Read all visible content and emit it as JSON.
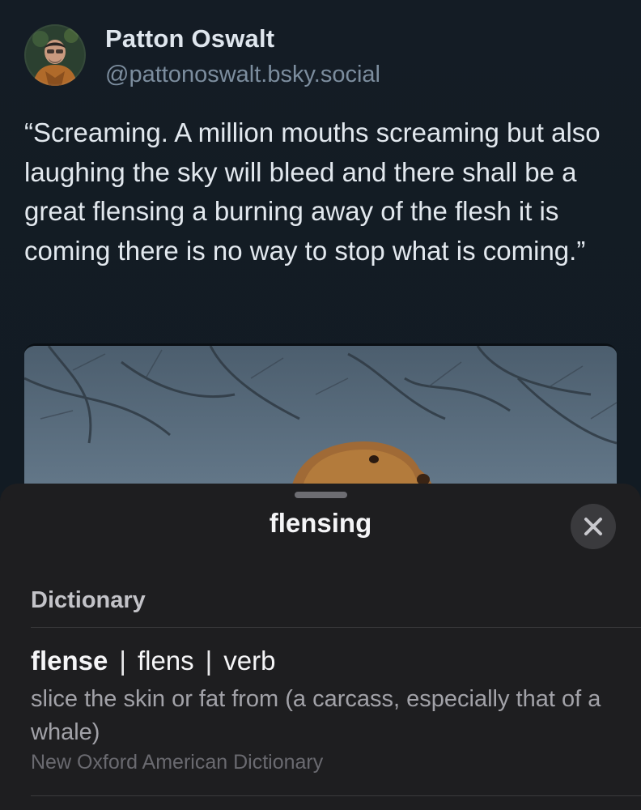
{
  "post": {
    "author_name": "Patton Oswalt",
    "author_handle": "@pattonoswalt.bsky.social",
    "text": "“Screaming. A million mouths screaming but also laughing the sky will bleed and there shall be a great flensing a burning away of the flesh it is coming there is no way to stop what is coming.”",
    "image_icon": "groundhog-photo",
    "avatar_icon": "author-avatar-photo"
  },
  "lookup_sheet": {
    "title": "flensing",
    "close_icon": "close-icon",
    "section_header": "Dictionary",
    "entry": {
      "word": "flense",
      "separator": "|",
      "pronunciation": "flens",
      "part_of_speech": "verb",
      "definition": "slice the skin or fat from (a carcass, especially that of a whale)",
      "source": "New Oxford American Dictionary"
    }
  }
}
